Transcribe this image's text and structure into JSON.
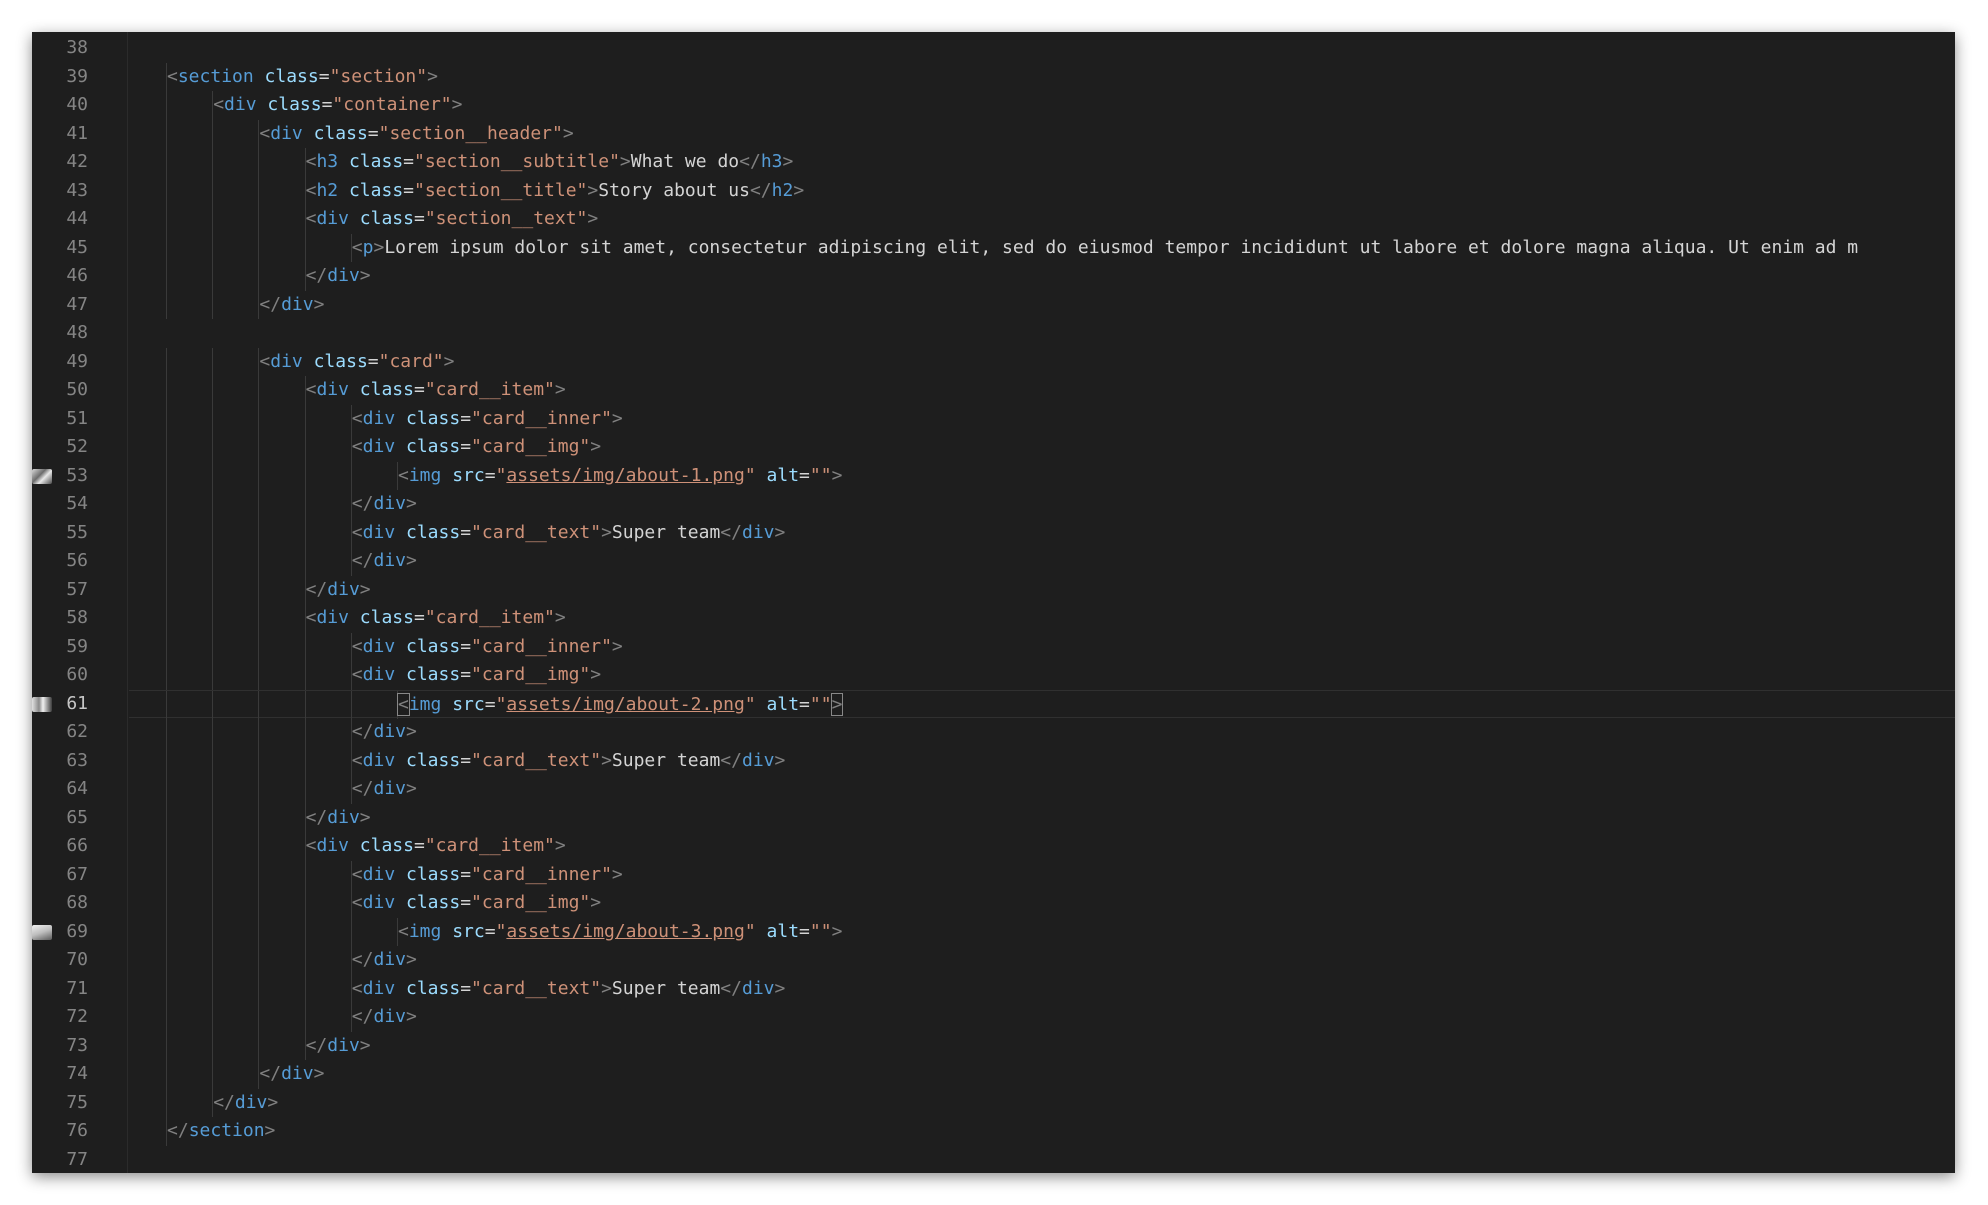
{
  "editor": {
    "colors": {
      "background": "#1e1e1e",
      "line_number": "#858585",
      "punctuation": "#808080",
      "tag": "#569cd6",
      "attribute": "#9cdcfe",
      "string": "#ce9178",
      "text": "#d4d4d4"
    },
    "active_line": 61,
    "lines": [
      {
        "n": 38,
        "indent": 0,
        "tokens": []
      },
      {
        "n": 39,
        "indent": 1,
        "tokens": [
          [
            "p",
            "<"
          ],
          [
            "t",
            "section"
          ],
          [
            "x",
            " "
          ],
          [
            "a",
            "class"
          ],
          [
            "x",
            "="
          ],
          [
            "s",
            "\"section\""
          ],
          [
            "p",
            ">"
          ]
        ]
      },
      {
        "n": 40,
        "indent": 2,
        "tokens": [
          [
            "p",
            "<"
          ],
          [
            "t",
            "div"
          ],
          [
            "x",
            " "
          ],
          [
            "a",
            "class"
          ],
          [
            "x",
            "="
          ],
          [
            "s",
            "\"container\""
          ],
          [
            "p",
            ">"
          ]
        ]
      },
      {
        "n": 41,
        "indent": 3,
        "tokens": [
          [
            "p",
            "<"
          ],
          [
            "t",
            "div"
          ],
          [
            "x",
            " "
          ],
          [
            "a",
            "class"
          ],
          [
            "x",
            "="
          ],
          [
            "s",
            "\"section__header\""
          ],
          [
            "p",
            ">"
          ]
        ]
      },
      {
        "n": 42,
        "indent": 4,
        "tokens": [
          [
            "p",
            "<"
          ],
          [
            "t",
            "h3"
          ],
          [
            "x",
            " "
          ],
          [
            "a",
            "class"
          ],
          [
            "x",
            "="
          ],
          [
            "s",
            "\"section__subtitle\""
          ],
          [
            "p",
            ">"
          ],
          [
            "x",
            "What we do"
          ],
          [
            "p",
            "</"
          ],
          [
            "t",
            "h3"
          ],
          [
            "p",
            ">"
          ]
        ]
      },
      {
        "n": 43,
        "indent": 4,
        "tokens": [
          [
            "p",
            "<"
          ],
          [
            "t",
            "h2"
          ],
          [
            "x",
            " "
          ],
          [
            "a",
            "class"
          ],
          [
            "x",
            "="
          ],
          [
            "s",
            "\"section__title\""
          ],
          [
            "p",
            ">"
          ],
          [
            "x",
            "Story about us"
          ],
          [
            "p",
            "</"
          ],
          [
            "t",
            "h2"
          ],
          [
            "p",
            ">"
          ]
        ]
      },
      {
        "n": 44,
        "indent": 4,
        "tokens": [
          [
            "p",
            "<"
          ],
          [
            "t",
            "div"
          ],
          [
            "x",
            " "
          ],
          [
            "a",
            "class"
          ],
          [
            "x",
            "="
          ],
          [
            "s",
            "\"section__text\""
          ],
          [
            "p",
            ">"
          ]
        ]
      },
      {
        "n": 45,
        "indent": 5,
        "tokens": [
          [
            "p",
            "<"
          ],
          [
            "t",
            "p"
          ],
          [
            "p",
            ">"
          ],
          [
            "x",
            "Lorem ipsum dolor sit amet, consectetur adipiscing elit, sed do eiusmod tempor incididunt ut labore et dolore magna aliqua. Ut enim ad m"
          ]
        ]
      },
      {
        "n": 46,
        "indent": 4,
        "tokens": [
          [
            "p",
            "</"
          ],
          [
            "t",
            "div"
          ],
          [
            "p",
            ">"
          ]
        ]
      },
      {
        "n": 47,
        "indent": 3,
        "tokens": [
          [
            "p",
            "</"
          ],
          [
            "t",
            "div"
          ],
          [
            "p",
            ">"
          ]
        ]
      },
      {
        "n": 48,
        "indent": 0,
        "tokens": []
      },
      {
        "n": 49,
        "indent": 3,
        "tokens": [
          [
            "p",
            "<"
          ],
          [
            "t",
            "div"
          ],
          [
            "x",
            " "
          ],
          [
            "a",
            "class"
          ],
          [
            "x",
            "="
          ],
          [
            "s",
            "\"card\""
          ],
          [
            "p",
            ">"
          ]
        ]
      },
      {
        "n": 50,
        "indent": 4,
        "tokens": [
          [
            "p",
            "<"
          ],
          [
            "t",
            "div"
          ],
          [
            "x",
            " "
          ],
          [
            "a",
            "class"
          ],
          [
            "x",
            "="
          ],
          [
            "s",
            "\"card__item\""
          ],
          [
            "p",
            ">"
          ]
        ]
      },
      {
        "n": 51,
        "indent": 5,
        "tokens": [
          [
            "p",
            "<"
          ],
          [
            "t",
            "div"
          ],
          [
            "x",
            " "
          ],
          [
            "a",
            "class"
          ],
          [
            "x",
            "="
          ],
          [
            "s",
            "\"card__inner\""
          ],
          [
            "p",
            ">"
          ]
        ]
      },
      {
        "n": 52,
        "indent": 5,
        "tokens": [
          [
            "p",
            "<"
          ],
          [
            "t",
            "div"
          ],
          [
            "x",
            " "
          ],
          [
            "a",
            "class"
          ],
          [
            "x",
            "="
          ],
          [
            "s",
            "\"card__img\""
          ],
          [
            "p",
            ">"
          ]
        ]
      },
      {
        "n": 53,
        "indent": 6,
        "thumb": "image-thumbnail-1",
        "tokens": [
          [
            "p",
            "<"
          ],
          [
            "t",
            "img"
          ],
          [
            "x",
            " "
          ],
          [
            "a",
            "src"
          ],
          [
            "x",
            "="
          ],
          [
            "s",
            "\""
          ],
          [
            "su",
            "assets/img/about-1.png"
          ],
          [
            "s",
            "\""
          ],
          [
            "x",
            " "
          ],
          [
            "a",
            "alt"
          ],
          [
            "x",
            "="
          ],
          [
            "s",
            "\"\""
          ],
          [
            "p",
            ">"
          ]
        ]
      },
      {
        "n": 54,
        "indent": 5,
        "tokens": [
          [
            "p",
            "</"
          ],
          [
            "t",
            "div"
          ],
          [
            "p",
            ">"
          ]
        ]
      },
      {
        "n": 55,
        "indent": 5,
        "tokens": [
          [
            "p",
            "<"
          ],
          [
            "t",
            "div"
          ],
          [
            "x",
            " "
          ],
          [
            "a",
            "class"
          ],
          [
            "x",
            "="
          ],
          [
            "s",
            "\"card__text\""
          ],
          [
            "p",
            ">"
          ],
          [
            "x",
            "Super team"
          ],
          [
            "p",
            "</"
          ],
          [
            "t",
            "div"
          ],
          [
            "p",
            ">"
          ]
        ]
      },
      {
        "n": 56,
        "indent": 5,
        "tokens": [
          [
            "p",
            "</"
          ],
          [
            "t",
            "div"
          ],
          [
            "p",
            ">"
          ]
        ]
      },
      {
        "n": 57,
        "indent": 4,
        "tokens": [
          [
            "p",
            "</"
          ],
          [
            "t",
            "div"
          ],
          [
            "p",
            ">"
          ]
        ]
      },
      {
        "n": 58,
        "indent": 4,
        "tokens": [
          [
            "p",
            "<"
          ],
          [
            "t",
            "div"
          ],
          [
            "x",
            " "
          ],
          [
            "a",
            "class"
          ],
          [
            "x",
            "="
          ],
          [
            "s",
            "\"card__item\""
          ],
          [
            "p",
            ">"
          ]
        ]
      },
      {
        "n": 59,
        "indent": 5,
        "tokens": [
          [
            "p",
            "<"
          ],
          [
            "t",
            "div"
          ],
          [
            "x",
            " "
          ],
          [
            "a",
            "class"
          ],
          [
            "x",
            "="
          ],
          [
            "s",
            "\"card__inner\""
          ],
          [
            "p",
            ">"
          ]
        ]
      },
      {
        "n": 60,
        "indent": 5,
        "tokens": [
          [
            "p",
            "<"
          ],
          [
            "t",
            "div"
          ],
          [
            "x",
            " "
          ],
          [
            "a",
            "class"
          ],
          [
            "x",
            "="
          ],
          [
            "s",
            "\"card__img\""
          ],
          [
            "p",
            ">"
          ]
        ]
      },
      {
        "n": 61,
        "indent": 6,
        "thumb": "image-thumbnail-2",
        "tokens": [
          [
            "pb",
            "<"
          ],
          [
            "t",
            "img"
          ],
          [
            "x",
            " "
          ],
          [
            "a",
            "src"
          ],
          [
            "x",
            "="
          ],
          [
            "s",
            "\""
          ],
          [
            "su",
            "assets/img/about-2.png"
          ],
          [
            "s",
            "\""
          ],
          [
            "x",
            " "
          ],
          [
            "a",
            "alt"
          ],
          [
            "x",
            "="
          ],
          [
            "s",
            "\"\""
          ],
          [
            "pb",
            ">"
          ]
        ]
      },
      {
        "n": 62,
        "indent": 5,
        "tokens": [
          [
            "p",
            "</"
          ],
          [
            "t",
            "div"
          ],
          [
            "p",
            ">"
          ]
        ]
      },
      {
        "n": 63,
        "indent": 5,
        "tokens": [
          [
            "p",
            "<"
          ],
          [
            "t",
            "div"
          ],
          [
            "x",
            " "
          ],
          [
            "a",
            "class"
          ],
          [
            "x",
            "="
          ],
          [
            "s",
            "\"card__text\""
          ],
          [
            "p",
            ">"
          ],
          [
            "x",
            "Super team"
          ],
          [
            "p",
            "</"
          ],
          [
            "t",
            "div"
          ],
          [
            "p",
            ">"
          ]
        ]
      },
      {
        "n": 64,
        "indent": 5,
        "tokens": [
          [
            "p",
            "</"
          ],
          [
            "t",
            "div"
          ],
          [
            "p",
            ">"
          ]
        ]
      },
      {
        "n": 65,
        "indent": 4,
        "tokens": [
          [
            "p",
            "</"
          ],
          [
            "t",
            "div"
          ],
          [
            "p",
            ">"
          ]
        ]
      },
      {
        "n": 66,
        "indent": 4,
        "tokens": [
          [
            "p",
            "<"
          ],
          [
            "t",
            "div"
          ],
          [
            "x",
            " "
          ],
          [
            "a",
            "class"
          ],
          [
            "x",
            "="
          ],
          [
            "s",
            "\"card__item\""
          ],
          [
            "p",
            ">"
          ]
        ]
      },
      {
        "n": 67,
        "indent": 5,
        "tokens": [
          [
            "p",
            "<"
          ],
          [
            "t",
            "div"
          ],
          [
            "x",
            " "
          ],
          [
            "a",
            "class"
          ],
          [
            "x",
            "="
          ],
          [
            "s",
            "\"card__inner\""
          ],
          [
            "p",
            ">"
          ]
        ]
      },
      {
        "n": 68,
        "indent": 5,
        "tokens": [
          [
            "p",
            "<"
          ],
          [
            "t",
            "div"
          ],
          [
            "x",
            " "
          ],
          [
            "a",
            "class"
          ],
          [
            "x",
            "="
          ],
          [
            "s",
            "\"card__img\""
          ],
          [
            "p",
            ">"
          ]
        ]
      },
      {
        "n": 69,
        "indent": 6,
        "thumb": "image-thumbnail-3",
        "tokens": [
          [
            "p",
            "<"
          ],
          [
            "t",
            "img"
          ],
          [
            "x",
            " "
          ],
          [
            "a",
            "src"
          ],
          [
            "x",
            "="
          ],
          [
            "s",
            "\""
          ],
          [
            "su",
            "assets/img/about-3.png"
          ],
          [
            "s",
            "\""
          ],
          [
            "x",
            " "
          ],
          [
            "a",
            "alt"
          ],
          [
            "x",
            "="
          ],
          [
            "s",
            "\"\""
          ],
          [
            "p",
            ">"
          ]
        ]
      },
      {
        "n": 70,
        "indent": 5,
        "tokens": [
          [
            "p",
            "</"
          ],
          [
            "t",
            "div"
          ],
          [
            "p",
            ">"
          ]
        ]
      },
      {
        "n": 71,
        "indent": 5,
        "tokens": [
          [
            "p",
            "<"
          ],
          [
            "t",
            "div"
          ],
          [
            "x",
            " "
          ],
          [
            "a",
            "class"
          ],
          [
            "x",
            "="
          ],
          [
            "s",
            "\"card__text\""
          ],
          [
            "p",
            ">"
          ],
          [
            "x",
            "Super team"
          ],
          [
            "p",
            "</"
          ],
          [
            "t",
            "div"
          ],
          [
            "p",
            ">"
          ]
        ]
      },
      {
        "n": 72,
        "indent": 5,
        "tokens": [
          [
            "p",
            "</"
          ],
          [
            "t",
            "div"
          ],
          [
            "p",
            ">"
          ]
        ]
      },
      {
        "n": 73,
        "indent": 4,
        "tokens": [
          [
            "p",
            "</"
          ],
          [
            "t",
            "div"
          ],
          [
            "p",
            ">"
          ]
        ]
      },
      {
        "n": 74,
        "indent": 3,
        "tokens": [
          [
            "p",
            "</"
          ],
          [
            "t",
            "div"
          ],
          [
            "p",
            ">"
          ]
        ]
      },
      {
        "n": 75,
        "indent": 2,
        "tokens": [
          [
            "p",
            "</"
          ],
          [
            "t",
            "div"
          ],
          [
            "p",
            ">"
          ]
        ]
      },
      {
        "n": 76,
        "indent": 1,
        "tokens": [
          [
            "p",
            "</"
          ],
          [
            "t",
            "section"
          ],
          [
            "p",
            ">"
          ]
        ]
      },
      {
        "n": 77,
        "indent": 0,
        "tokens": []
      }
    ]
  }
}
